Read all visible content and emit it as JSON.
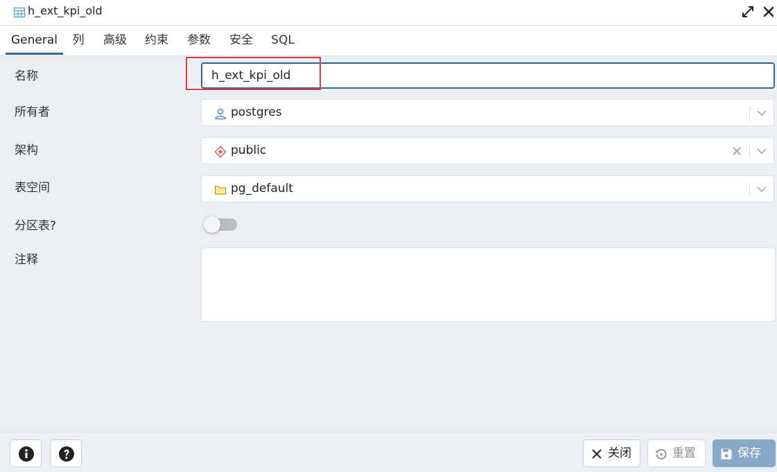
{
  "window": {
    "title": "h_ext_kpi_old",
    "expand_icon": "expand-icon",
    "close_icon": "close-icon"
  },
  "tabs": [
    {
      "label": "General",
      "active": true
    },
    {
      "label": "列"
    },
    {
      "label": "高级"
    },
    {
      "label": "约束"
    },
    {
      "label": "参数"
    },
    {
      "label": "安全"
    },
    {
      "label": "SQL"
    }
  ],
  "form": {
    "name": {
      "label": "名称",
      "value": "h_ext_kpi_old"
    },
    "owner": {
      "label": "所有者",
      "value": "postgres",
      "icon": "user-icon"
    },
    "schema": {
      "label": "架构",
      "value": "public",
      "icon": "schema-diamond-icon"
    },
    "tablespace": {
      "label": "表空间",
      "value": "pg_default",
      "icon": "folder-icon"
    },
    "partitioned": {
      "label": "分区表?",
      "value": false
    },
    "comment": {
      "label": "注释",
      "value": ""
    }
  },
  "footer": {
    "info_icon": "info-icon",
    "help_icon": "help-icon",
    "close_label": "关闭",
    "reset_label": "重置",
    "save_label": "保存"
  },
  "colors": {
    "accent": "#326690",
    "highlight": "#e8383d",
    "save_button": "#86a8c6",
    "background": "#ebeef3"
  }
}
